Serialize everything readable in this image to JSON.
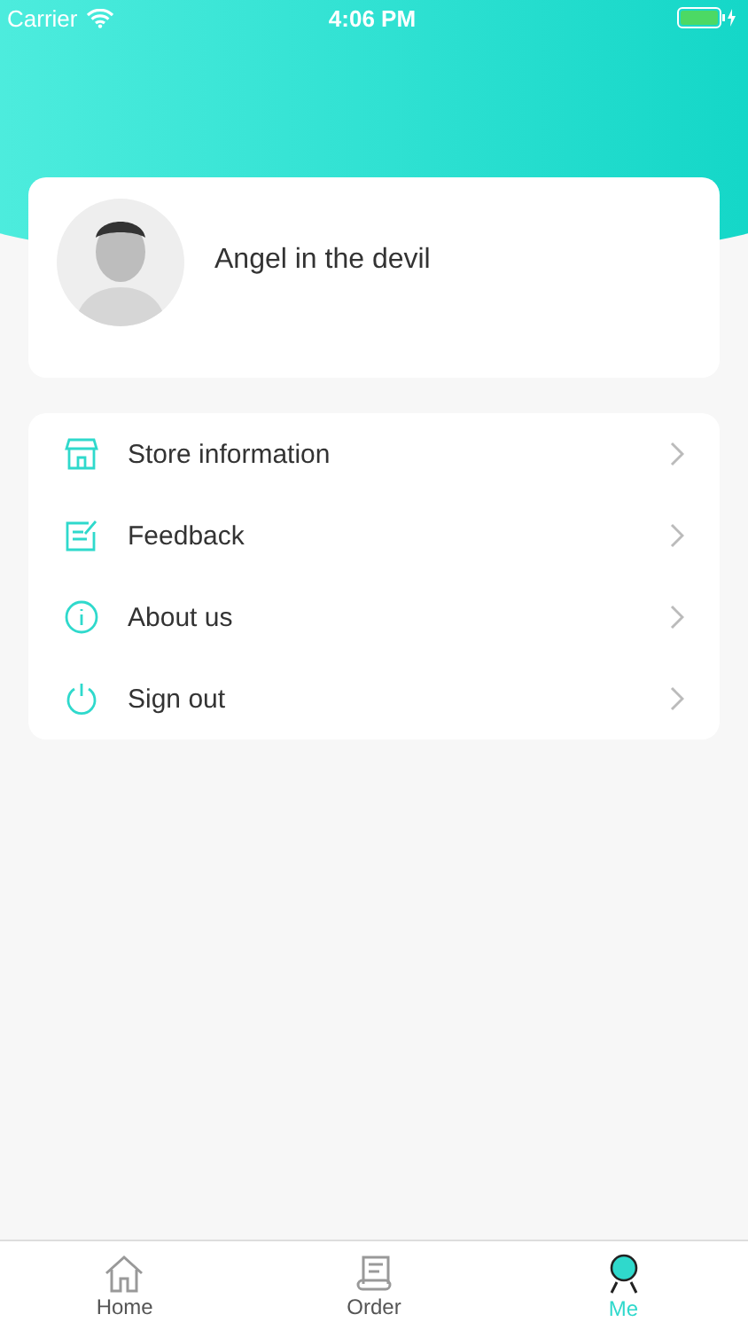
{
  "status_bar": {
    "carrier": "Carrier",
    "time": "4:06 PM"
  },
  "profile": {
    "name": "Angel in the devil"
  },
  "menu": [
    {
      "label": "Store information"
    },
    {
      "label": "Feedback"
    },
    {
      "label": "About us"
    },
    {
      "label": "Sign out"
    }
  ],
  "tab_bar": [
    {
      "label": "Home",
      "selected": false
    },
    {
      "label": "Order",
      "selected": false
    },
    {
      "label": "Me",
      "selected": true
    }
  ]
}
